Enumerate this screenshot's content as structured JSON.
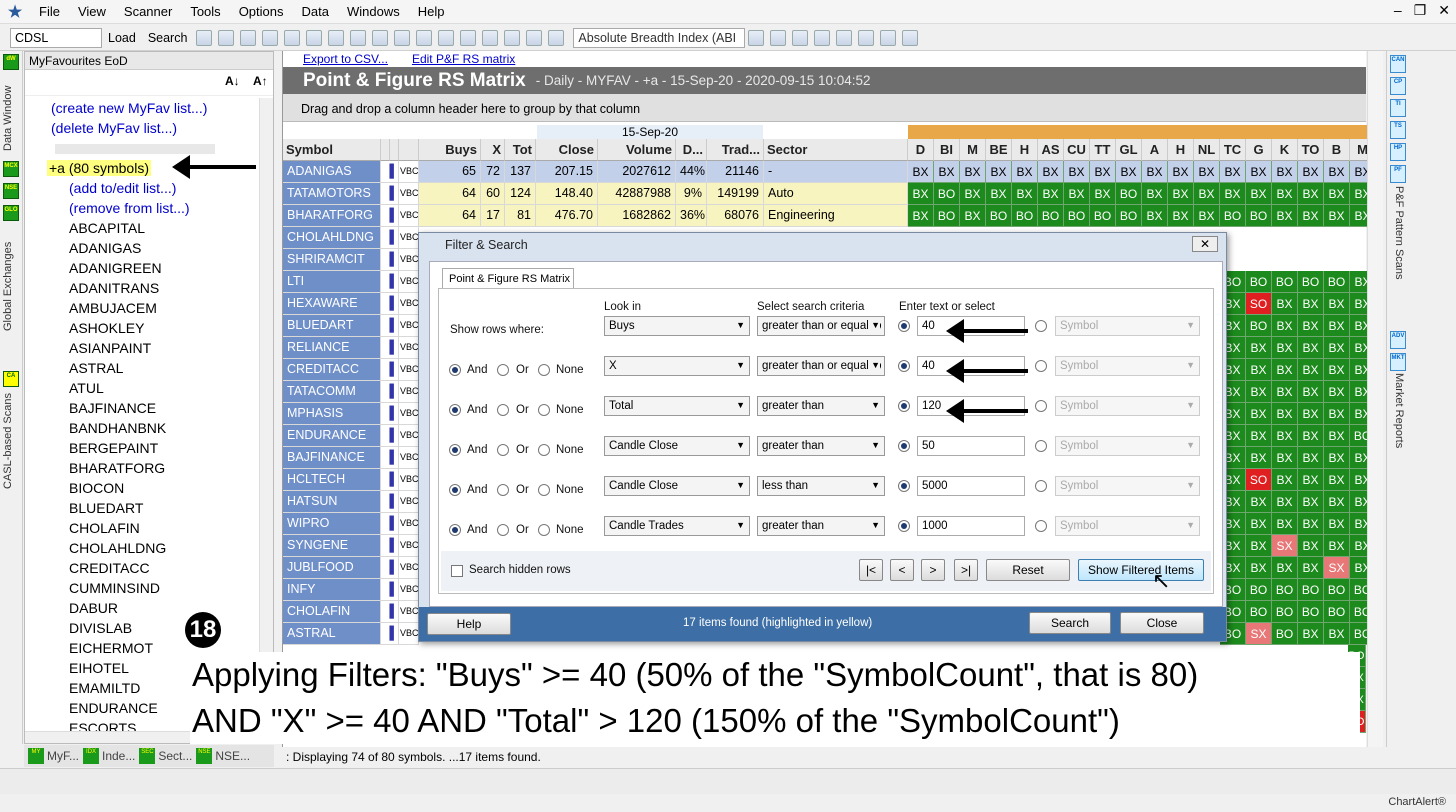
{
  "menu": {
    "items": [
      "File",
      "View",
      "Scanner",
      "Tools",
      "Options",
      "Data",
      "Windows",
      "Help"
    ]
  },
  "toolbar": {
    "symbol": "CDSL",
    "load": "Load",
    "search": "Search",
    "indicator": "Absolute Breadth Index (ABI"
  },
  "left_panel": {
    "title": "MyFavourites EoD",
    "links": [
      "(create new MyFav list...)",
      "(delete MyFav list...)"
    ],
    "selected": "+a (80 symbols)",
    "sublinks": [
      "(add to/edit list...)",
      "(remove from list...)"
    ],
    "symbols": [
      "ABCAPITAL",
      "ADANIGAS",
      "ADANIGREEN",
      "ADANITRANS",
      "AMBUJACEM",
      "ASHOKLEY",
      "ASIANPAINT",
      "ASTRAL",
      "ATUL",
      "BAJFINANCE",
      "BANDHANBNK",
      "BERGEPAINT",
      "BHARATFORG",
      "BIOCON",
      "BLUEDART",
      "CHOLAFIN",
      "CHOLAHLDNG",
      "CREDITACC",
      "CUMMINSIND",
      "DABUR",
      "DIVISLAB",
      "EICHERMOT",
      "EIHOTEL",
      "EMAMILTD",
      "ENDURANCE",
      "ESCORTS"
    ]
  },
  "side_tabs": {
    "left": [
      "Data Window",
      "Global Exchanges",
      "CASL-based Scans"
    ],
    "right": [
      "P&F Pattern Scans",
      "Market Reports"
    ]
  },
  "bottom_tabs": [
    "MyF...",
    "Inde...",
    "Sect...",
    "NSE..."
  ],
  "main": {
    "links": [
      "Export to CSV...",
      "Edit P&F RS matrix"
    ],
    "title": "Point & Figure RS Matrix",
    "subtitle": "- Daily - MYFAV - +a - 15-Sep-20 - 2020-09-15 10:04:52",
    "group_hint": "Drag and drop a column header here to group by that column",
    "date_header": "15-Sep-20",
    "columns": [
      "Symbol",
      "Buys",
      "X",
      "Tot",
      "Close",
      "Volume",
      "D...",
      "Trad...",
      "Sector"
    ],
    "matrix_columns": [
      "D",
      "BI",
      "M",
      "BE",
      "H",
      "AS",
      "CU",
      "TT",
      "GL",
      "A",
      "H",
      "NL",
      "TC",
      "G",
      "K",
      "TO",
      "B",
      "M"
    ],
    "rows": [
      {
        "symbol": "ADANIGAS",
        "buys": "65",
        "x": "72",
        "tot": "137",
        "close": "207.15",
        "volume": "2027612",
        "d": "44%",
        "trades": "21146",
        "sector": "-",
        "matrix": [
          "BX",
          "BX",
          "BX",
          "BX",
          "BX",
          "BX",
          "BX",
          "BX",
          "BX",
          "BX",
          "BX",
          "BX",
          "BX",
          "BX",
          "BX",
          "BX",
          "BX",
          "BX"
        ]
      },
      {
        "symbol": "TATAMOTORS",
        "buys": "64",
        "x": "60",
        "tot": "124",
        "close": "148.40",
        "volume": "42887988",
        "d": "9%",
        "trades": "149199",
        "sector": "Auto",
        "matrix": [
          "BX",
          "BO",
          "BX",
          "BX",
          "BX",
          "BX",
          "BX",
          "BX",
          "BO",
          "BX",
          "BX",
          "BX",
          "BX",
          "BX",
          "BX",
          "BX",
          "BX",
          "BX"
        ]
      },
      {
        "symbol": "BHARATFORG",
        "buys": "64",
        "x": "17",
        "tot": "81",
        "close": "476.70",
        "volume": "1682862",
        "d": "36%",
        "trades": "68076",
        "sector": "Engineering",
        "matrix": [
          "BX",
          "BO",
          "BX",
          "BO",
          "BO",
          "BO",
          "BO",
          "BO",
          "BO",
          "BX",
          "BX",
          "BX",
          "BO",
          "BO",
          "BX",
          "BX",
          "BX",
          "BX"
        ]
      },
      {
        "symbol": "CHOLAHLDNG"
      },
      {
        "symbol": "SHRIRAMCIT"
      },
      {
        "symbol": "LTI"
      },
      {
        "symbol": "HEXAWARE"
      },
      {
        "symbol": "BLUEDART"
      },
      {
        "symbol": "RELIANCE"
      },
      {
        "symbol": "CREDITACC"
      },
      {
        "symbol": "TATACOMM"
      },
      {
        "symbol": "MPHASIS"
      },
      {
        "symbol": "ENDURANCE"
      },
      {
        "symbol": "BAJFINANCE"
      },
      {
        "symbol": "HCLTECH"
      },
      {
        "symbol": "HATSUN"
      },
      {
        "symbol": "WIPRO"
      },
      {
        "symbol": "SYNGENE"
      },
      {
        "symbol": "JUBLFOOD"
      },
      {
        "symbol": "INFY"
      },
      {
        "symbol": "CHOLAFIN"
      },
      {
        "symbol": "ASTRAL"
      }
    ],
    "vbc": "VBC",
    "right_matrix": [
      [
        "BO",
        "BO",
        "BO",
        "BO",
        "BO",
        "BX"
      ],
      [
        "BX",
        "SO",
        "BX",
        "BX",
        "BX",
        "BX"
      ],
      [
        "BX",
        "BO",
        "BX",
        "BX",
        "BX",
        "BX"
      ],
      [
        "BX",
        "BX",
        "BX",
        "BX",
        "BX",
        "BX"
      ],
      [
        "BX",
        "BX",
        "BX",
        "BX",
        "BX",
        "BX"
      ],
      [
        "BX",
        "BX",
        "BX",
        "BX",
        "BX",
        "BX"
      ],
      [
        "BX",
        "BX",
        "BX",
        "BX",
        "BX",
        "BX"
      ],
      [
        "BX",
        "BX",
        "BX",
        "BX",
        "BX",
        "BO"
      ],
      [
        "BX",
        "BX",
        "BX",
        "BX",
        "BX",
        "BX"
      ],
      [
        "BX",
        "SO",
        "BX",
        "BX",
        "BX",
        "BX"
      ],
      [
        "BX",
        "BX",
        "BX",
        "BX",
        "BX",
        "BX"
      ],
      [
        "BX",
        "BX",
        "BX",
        "BX",
        "BX",
        "BX"
      ],
      [
        "BX",
        "BX",
        "SX",
        "BX",
        "BX",
        "BX"
      ],
      [
        "BX",
        "BX",
        "BX",
        "BX",
        "SX",
        "BX"
      ],
      [
        "BO",
        "BO",
        "BO",
        "BO",
        "BO",
        "BO"
      ],
      [
        "BO",
        "BO",
        "BO",
        "BO",
        "BO",
        "BO"
      ],
      [
        "BO",
        "SX",
        "BO",
        "BX",
        "BX",
        "BO"
      ]
    ],
    "far_right": [
      "BO",
      "BX",
      "BX",
      "SO"
    ]
  },
  "dialog": {
    "title": "Filter & Search",
    "tab": "Point & Figure RS Matrix",
    "headers": {
      "look_in": "Look in",
      "criteria": "Select search criteria",
      "enter": "Enter text or select"
    },
    "show_rows": "Show rows where:",
    "and": "And",
    "or": "Or",
    "none": "None",
    "rows": [
      {
        "look": "Buys",
        "crit": "greater than or equal to",
        "val": "40"
      },
      {
        "look": "X",
        "crit": "greater than or equal to",
        "val": "40"
      },
      {
        "look": "Total",
        "crit": "greater than",
        "val": "120"
      },
      {
        "look": "Candle Close",
        "crit": "greater than",
        "val": "50"
      },
      {
        "look": "Candle Close",
        "crit": "less than",
        "val": "5000"
      },
      {
        "look": "Candle Trades",
        "crit": "greater than",
        "val": "1000"
      }
    ],
    "symbol_placeholder": "Symbol",
    "search_hidden": "Search hidden rows",
    "nav": [
      "|<",
      "<",
      ">",
      ">|"
    ],
    "reset": "Reset",
    "show_filtered": "Show Filtered Items",
    "help": "Help",
    "found": "17 items found (highlighted in yellow)",
    "search": "Search",
    "close": "Close"
  },
  "annotation": {
    "step": "18",
    "line1": "Applying Filters: \"Buys\" >= 40 (50% of the \"SymbolCount\", that is 80)",
    "line2": "AND \"X\" >= 40 AND \"Total\" > 120 (150% of the \"SymbolCount\")"
  },
  "status": ": Displaying 74 of 80 symbols. ...17 items found.",
  "brand": "ChartAlert®",
  "colors": {
    "sym_bg": "#6f8fc9",
    "green": "#1c8a1c",
    "highlight": "#f8f4c0",
    "red": "#e02020",
    "pink": "#e87878",
    "dialog_footer": "#3d6fa6"
  }
}
